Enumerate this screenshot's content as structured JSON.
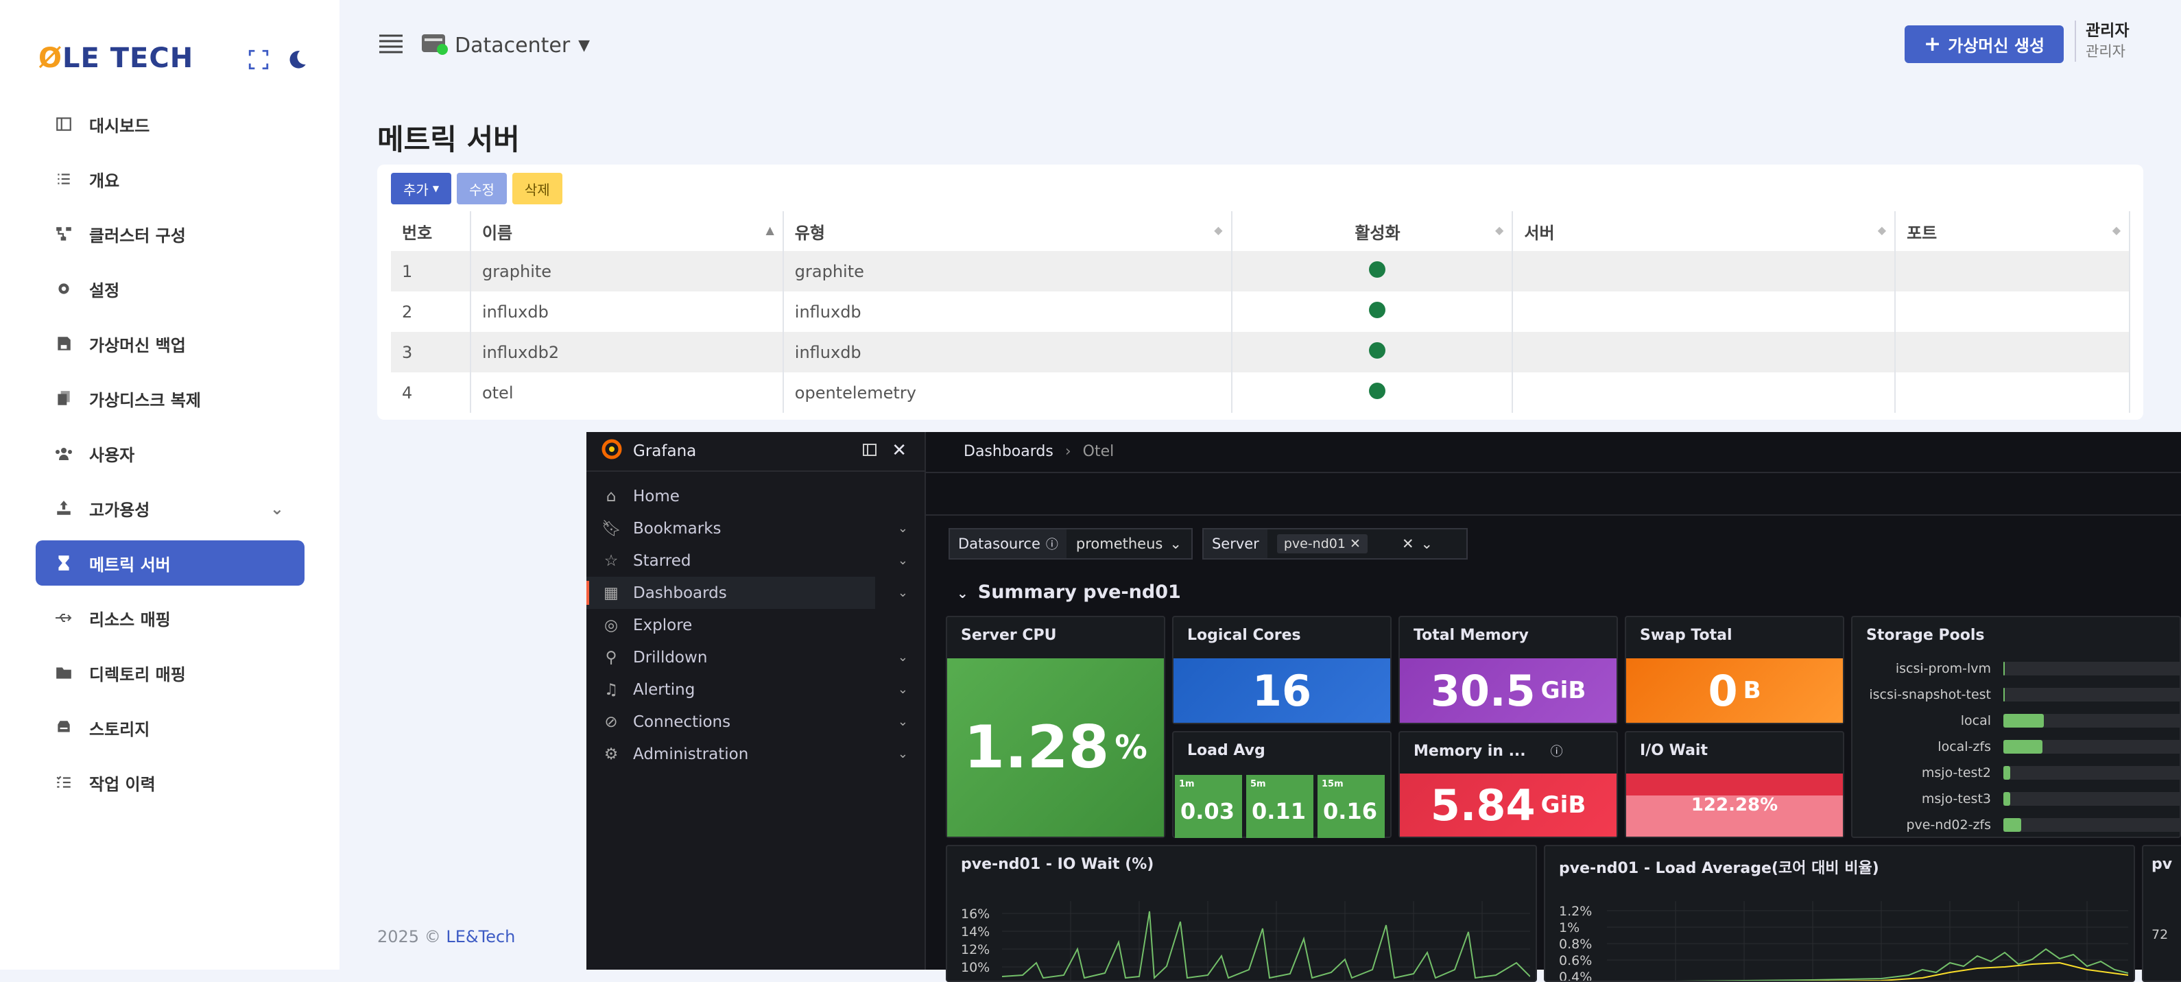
{
  "brand": {
    "logo_prefix": "Ø",
    "logo_text": "LE TECH"
  },
  "sidebar": {
    "items": [
      {
        "label": "대시보드",
        "icon": "layout-icon"
      },
      {
        "label": "개요",
        "icon": "list-icon"
      },
      {
        "label": "클러스터 구성",
        "icon": "cluster-icon"
      },
      {
        "label": "설정",
        "icon": "gear-icon"
      },
      {
        "label": "가상머신 백업",
        "icon": "save-icon"
      },
      {
        "label": "가상디스크 복제",
        "icon": "copy-icon"
      },
      {
        "label": "사용자",
        "icon": "users-icon"
      },
      {
        "label": "고가용성",
        "icon": "ha-icon"
      },
      {
        "label": "메트릭 서버",
        "icon": "hourglass-icon"
      },
      {
        "label": "리소스 매핑",
        "icon": "usb-icon"
      },
      {
        "label": "디렉토리 매핑",
        "icon": "folder-icon"
      },
      {
        "label": "스토리지",
        "icon": "storage-icon"
      },
      {
        "label": "작업 이력",
        "icon": "tasks-icon"
      }
    ]
  },
  "topbar": {
    "datacenter": "Datacenter",
    "create_label": "가상머신 생성",
    "user_name": "관리자",
    "user_role": "관리자"
  },
  "page": {
    "title": "메트릭 서버"
  },
  "toolbar": {
    "add": "추가",
    "edit": "수정",
    "delete": "삭제"
  },
  "table": {
    "headers": [
      "번호",
      "이름",
      "유형",
      "활성화",
      "서버",
      "포트"
    ],
    "rows": [
      {
        "no": "1",
        "name": "graphite",
        "type": "graphite",
        "enabled": true,
        "server": "",
        "port": ""
      },
      {
        "no": "2",
        "name": "influxdb",
        "type": "influxdb",
        "enabled": true,
        "server": "",
        "port": ""
      },
      {
        "no": "3",
        "name": "influxdb2",
        "type": "influxdb",
        "enabled": true,
        "server": "",
        "port": ""
      },
      {
        "no": "4",
        "name": "otel",
        "type": "opentelemetry",
        "enabled": true,
        "server": "",
        "port": ""
      }
    ]
  },
  "footer": {
    "year": "2025 ©",
    "company": "LE&Tech"
  },
  "grafana": {
    "brand": "Grafana",
    "nav": [
      {
        "label": "Home",
        "icon": "home-icon"
      },
      {
        "label": "Bookmarks",
        "icon": "bookmark-icon"
      },
      {
        "label": "Starred",
        "icon": "star-icon"
      },
      {
        "label": "Dashboards",
        "icon": "grid-icon"
      },
      {
        "label": "Explore",
        "icon": "compass-icon"
      },
      {
        "label": "Drilldown",
        "icon": "drilldown-icon"
      },
      {
        "label": "Alerting",
        "icon": "bell-icon"
      },
      {
        "label": "Connections",
        "icon": "link-icon"
      },
      {
        "label": "Administration",
        "icon": "cog-icon"
      }
    ],
    "breadcrumb": [
      "Dashboards",
      "Otel"
    ],
    "vars": {
      "datasource_label": "Datasource",
      "datasource_value": "prometheus",
      "server_label": "Server",
      "server_value": "pve-nd01"
    },
    "row_title": "Summary pve-nd01",
    "panels": {
      "cpu": {
        "title": "Server CPU",
        "value": "1.28",
        "unit": "%"
      },
      "cores": {
        "title": "Logical Cores",
        "value": "16"
      },
      "mem": {
        "title": "Total Memory",
        "value": "30.5",
        "unit": "GiB"
      },
      "swap": {
        "title": "Swap Total",
        "value": "0",
        "unit": "B"
      },
      "load": {
        "title": "Load Avg",
        "items": [
          {
            "k": "1m",
            "v": "0.03"
          },
          {
            "k": "5m",
            "v": "0.11"
          },
          {
            "k": "15m",
            "v": "0.16"
          }
        ]
      },
      "memuse": {
        "title": "Memory in ...",
        "value": "5.84",
        "unit": "GiB"
      },
      "iowait": {
        "title": "I/O Wait",
        "value": "122.28%"
      },
      "pools": {
        "title": "Storage Pools",
        "items": [
          {
            "name": "iscsi-prom-lvm",
            "level": 0.005
          },
          {
            "name": "iscsi-snapshot-test",
            "level": 0.005
          },
          {
            "name": "local",
            "level": 0.23
          },
          {
            "name": "local-zfs",
            "level": 0.22
          },
          {
            "name": "msjo-test2",
            "level": 0.04
          },
          {
            "name": "msjo-test3",
            "level": 0.04
          },
          {
            "name": "pve-nd02-zfs",
            "level": 0.1
          }
        ]
      },
      "io_chart": {
        "title": "pve-nd01 - IO Wait (%)",
        "yticks": [
          "16%",
          "14%",
          "12%",
          "10%"
        ]
      },
      "load_chart": {
        "title": "pve-nd01 - Load Average(코어 대비 비율)",
        "yticks": [
          "1.2%",
          "1%",
          "0.8%",
          "0.6%",
          "0.4%"
        ]
      },
      "third": {
        "title": "pv",
        "yticks": [
          "72"
        ]
      }
    }
  },
  "colors": {
    "accent": "#4462c8",
    "green_stat": "#4ea34a",
    "blue_stat": "#1f60c4",
    "purple_stat": "#8f3bb8",
    "orange_stat": "#f2720c",
    "red_stat": "#e02f44"
  }
}
